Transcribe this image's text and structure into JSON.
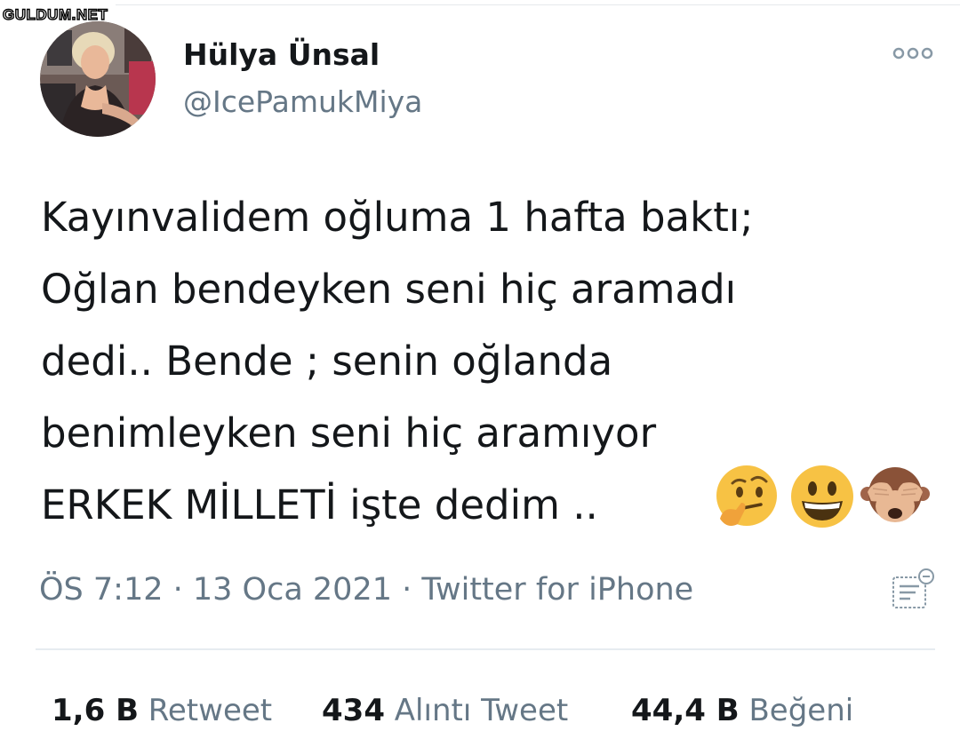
{
  "watermark": "GULDUM.NET",
  "user": {
    "display_name": "Hülya Ünsal",
    "handle": "@IcePamukMiya"
  },
  "tweet": {
    "lines": [
      "Kayınvalidem oğluma 1 hafta baktı;",
      "Oğlan bendeyken seni hiç aramadı",
      "dedi..  Bende ; senin oğlanda",
      "benimleyken seni hiç aramıyor",
      "ERKEK MİLLETİ işte dedim .."
    ],
    "emojis": [
      "thinking-face-emoji",
      "grinning-face-emoji",
      "see-no-evil-monkey-emoji"
    ]
  },
  "meta": {
    "time": "ÖS 7:12",
    "sep1": " · ",
    "date": "13 Oca 2021",
    "sep2": " · ",
    "source": "Twitter for iPhone"
  },
  "stats": {
    "retweets": {
      "value": "1,6 B",
      "label": "Retweet"
    },
    "quotes": {
      "value": "434",
      "label": "Alıntı Tweet"
    },
    "likes": {
      "value": "44,4 B",
      "label": "Beğeni"
    }
  },
  "colors": {
    "text": "#14171a",
    "secondary": "#657786",
    "divider": "#e6ecf0"
  },
  "icons": {
    "more": "more-dots-icon",
    "analytics": "analytics-icon"
  }
}
